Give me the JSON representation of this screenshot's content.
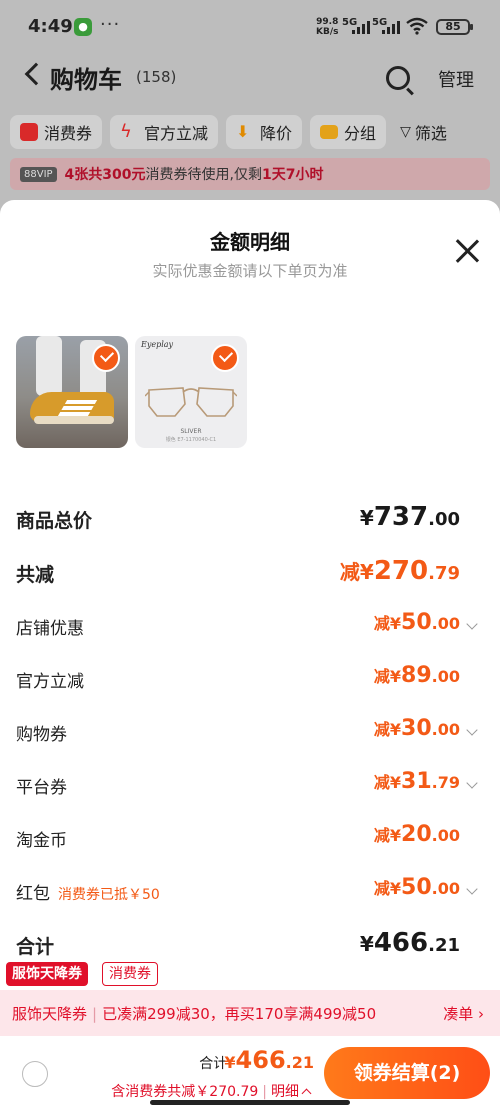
{
  "status_bar": {
    "time": "4:49",
    "more": "···",
    "speed_value": "99.8",
    "speed_unit": "KB/s",
    "sig1": "5G",
    "sig2": "5G",
    "battery": "85"
  },
  "header": {
    "title": "购物车",
    "count": "(158)",
    "manage": "管理"
  },
  "filters": [
    "消费券",
    "官方立减",
    "降价",
    "分组",
    "筛选"
  ],
  "promo": {
    "vip": "88VIP",
    "hl1": "4张共300元",
    "mid": "消费券待使用,仅剩",
    "hl2": "1天7小时"
  },
  "sheet": {
    "title": "金额明细",
    "subtitle": "实际优惠金额请以下单页为准",
    "product2": {
      "brand": "Eyeplay",
      "caption": "SLIVER",
      "sub": "银色 E7-1170040-C1"
    },
    "rows": {
      "total": {
        "label": "商品总价",
        "p": "¥",
        "i": "737",
        "d": ".00"
      },
      "reduce": {
        "label": "共减",
        "p": "减¥",
        "i": "270",
        "d": ".79"
      },
      "shop": {
        "label": "店铺优惠",
        "p": "减¥",
        "i": "50",
        "d": ".00"
      },
      "official": {
        "label": "官方立减",
        "p": "减¥",
        "i": "89",
        "d": ".00"
      },
      "shopping_coupon": {
        "label": "购物券",
        "p": "减¥",
        "i": "30",
        "d": ".00"
      },
      "platform_coupon": {
        "label": "平台券",
        "p": "减¥",
        "i": "31",
        "d": ".79"
      },
      "taojinbi": {
        "label": "淘金币",
        "p": "减¥",
        "i": "20",
        "d": ".00"
      },
      "redpacket": {
        "label": "红包",
        "note": "消费券已抵￥50",
        "p": "减¥",
        "i": "50",
        "d": ".00"
      },
      "grand": {
        "label": "合计",
        "p": "¥",
        "i": "466",
        "d": ".21"
      }
    }
  },
  "voucher": {
    "tag1": "服饰天降券",
    "tag2": "消费券",
    "text_a": "服饰天降券",
    "text_sep": "|",
    "text_b": "已凑满299减30，再买170享满499减50",
    "more": "凑单"
  },
  "bottom": {
    "sum_label": "合计:",
    "sum_p": "¥",
    "sum_i": "466",
    "sum_d": ".21",
    "note_a": "含消费券共减￥270.79",
    "note_sep": "|",
    "note_b": "明细",
    "checkout": "领券结算(2)"
  },
  "colors": {
    "accent": "#f35a16",
    "red": "#e0102a",
    "overlay": "#9a9a9a"
  }
}
